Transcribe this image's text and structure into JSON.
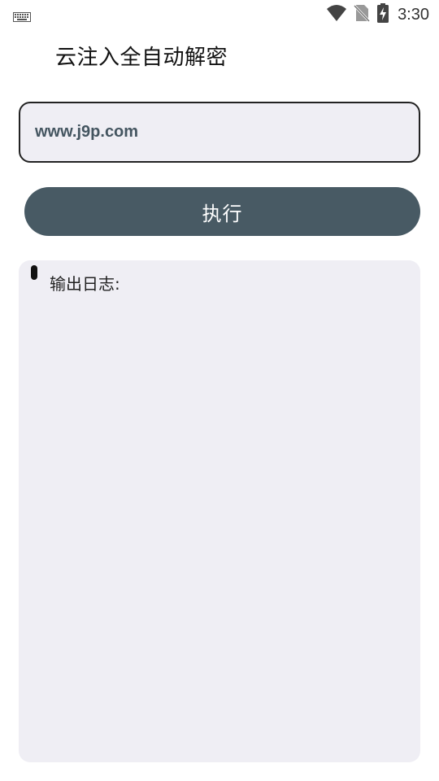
{
  "status_bar": {
    "time": "3:30",
    "icons": [
      "keyboard-icon",
      "wifi-icon",
      "no-sim-icon",
      "battery-charging-icon"
    ]
  },
  "app": {
    "title": "云注入全自动解密"
  },
  "url_input": {
    "value": "www.j9p.com",
    "placeholder": ""
  },
  "execute_button": {
    "label": "执行"
  },
  "log": {
    "label": "输出日志:",
    "content": ""
  },
  "colors": {
    "button_bg": "#485a64",
    "panel_bg": "#efeef4",
    "input_text": "#445560"
  }
}
